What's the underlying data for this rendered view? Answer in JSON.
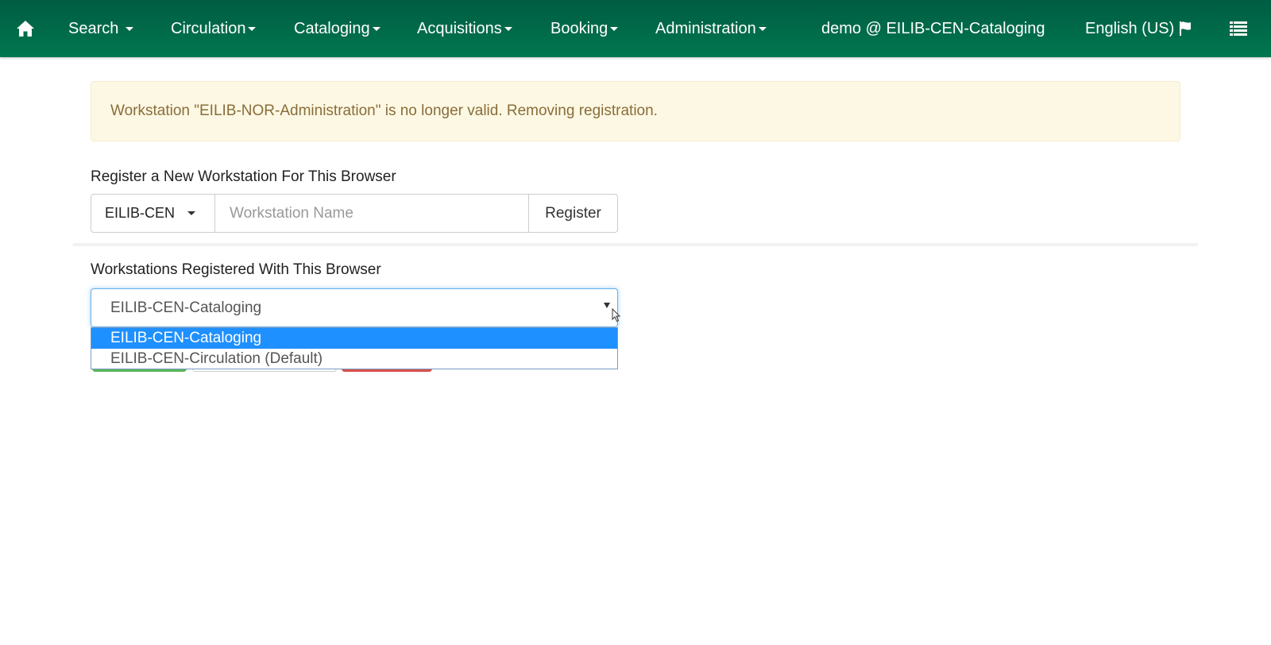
{
  "navbar": {
    "home_icon": "home-icon",
    "menus": [
      {
        "label": "Search"
      },
      {
        "label": "Circulation"
      },
      {
        "label": "Cataloging"
      },
      {
        "label": "Acquisitions"
      },
      {
        "label": "Booking"
      },
      {
        "label": "Administration"
      }
    ],
    "user_workstation": "demo @ EILIB-CEN-Cataloging",
    "locale": "English (US)",
    "locale_icon": "flag-icon",
    "menu_icon": "list-icon",
    "colors": {
      "bar_top": "#005c42",
      "bar_bottom": "#00774f"
    }
  },
  "alert": {
    "message": "Workstation \"EILIB-NOR-Administration\"  is no longer valid. Removing registration.",
    "type": "warning"
  },
  "register": {
    "heading": "Register a New Workstation For This Browser",
    "org_unit": "EILIB-CEN",
    "name_value": "",
    "name_placeholder": "Workstation Name",
    "register_label": "Register"
  },
  "registered": {
    "heading": "Workstations Registered With This Browser",
    "selected": "EILIB-CEN-Cataloging",
    "options": [
      {
        "label": "EILIB-CEN-Cataloging",
        "highlighted": true
      },
      {
        "label": "EILIB-CEN-Circulation (Default)",
        "highlighted": false
      }
    ]
  }
}
